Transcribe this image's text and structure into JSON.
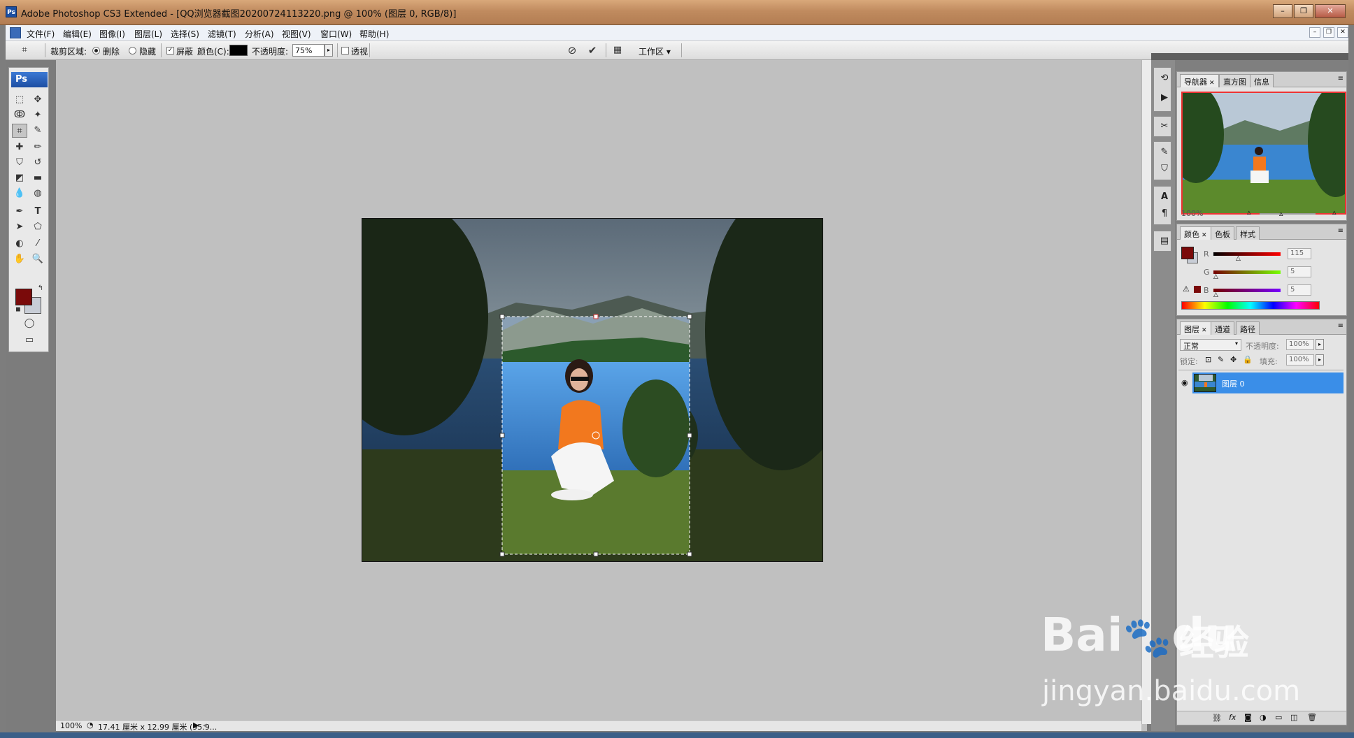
{
  "window": {
    "title": "Adobe Photoshop CS3 Extended - [QQ浏览器截图20200724113220.png @ 100% (图层 0, RGB/8)]",
    "app_icon": "Ps"
  },
  "menu": [
    "文件(F)",
    "编辑(E)",
    "图像(I)",
    "图层(L)",
    "选择(S)",
    "滤镜(T)",
    "分析(A)",
    "视图(V)",
    "窗口(W)",
    "帮助(H)"
  ],
  "options_bar": {
    "crop_area_label": "裁剪区域:",
    "delete_label": "删除",
    "hide_label": "隐藏",
    "shield_label": "屏蔽",
    "color_label": "颜色(C):",
    "opacity_label": "不透明度:",
    "opacity_value": "75%",
    "perspective_label": "透视",
    "workspace_label": "工作区"
  },
  "toolbox": {
    "badge": "Ps"
  },
  "status": {
    "zoom": "100%",
    "doc_info": "17.41 厘米 x 12.99 厘米 (95.9..."
  },
  "navigator": {
    "tabs": [
      "导航器",
      "直方图",
      "信息"
    ],
    "zoom": "100%"
  },
  "color_panel": {
    "tabs": [
      "颜色",
      "色板",
      "样式"
    ],
    "r_label": "R",
    "g_label": "G",
    "b_label": "B",
    "r_value": "115",
    "g_value": "5",
    "b_value": "5"
  },
  "layers_panel": {
    "tabs": [
      "图层",
      "通道",
      "路径"
    ],
    "blend_mode": "正常",
    "opacity_label": "不透明度:",
    "opacity_value": "100%",
    "lock_label": "锁定:",
    "fill_label": "填充:",
    "fill_value": "100%",
    "layer_name": "图层 0"
  },
  "watermark": {
    "brand": "Bai",
    "brand2": "du",
    "cn": "经验",
    "url": "jingyan.baidu.com"
  },
  "colors": {
    "foreground": "#7a0a0a",
    "background": "#c8cdd6",
    "selection": "#3a8ee8"
  }
}
